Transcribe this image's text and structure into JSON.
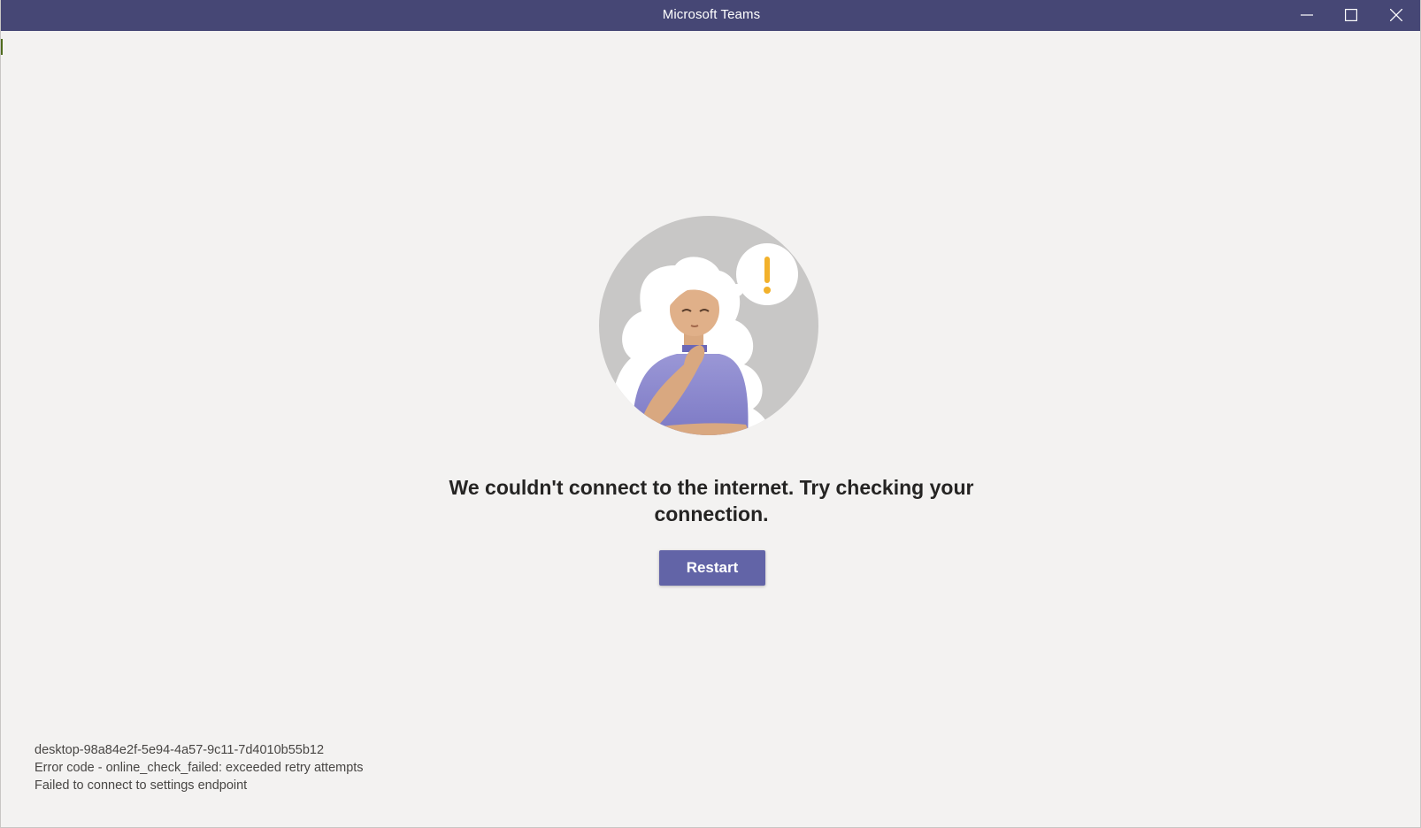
{
  "window": {
    "title": "Microsoft Teams",
    "controls": {
      "minimize_icon": "minimize-icon",
      "maximize_icon": "maximize-icon",
      "close_icon": "close-icon"
    }
  },
  "colors": {
    "titlebar": "#464775",
    "background": "#f3f2f1",
    "button": "#6264a7",
    "text": "#252423",
    "alert_accent": "#f2b12b"
  },
  "illustration": {
    "icon": "woman-thinking-alert-illustration"
  },
  "main": {
    "message": "We couldn't connect to the internet. Try checking your connection.",
    "restart_label": "Restart"
  },
  "diagnostics": {
    "device_id": "desktop-98a84e2f-5e94-4a57-9c11-7d4010b55b12",
    "error_code": "Error code - online_check_failed: exceeded retry attempts",
    "detail": "Failed to connect to settings endpoint"
  }
}
